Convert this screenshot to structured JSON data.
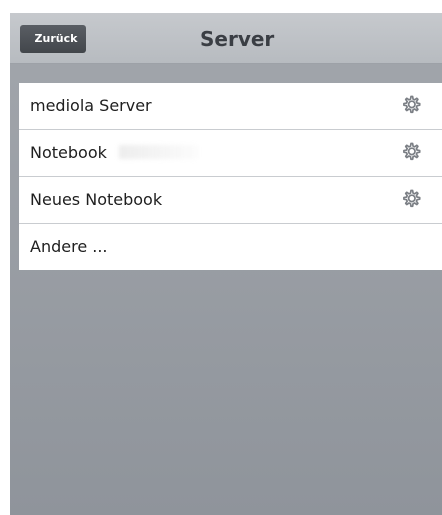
{
  "navbar": {
    "back_label": "Zurück",
    "title": "Server"
  },
  "servers": [
    {
      "label": "mediola Server",
      "has_settings": true,
      "settings_icon": "gear-icon"
    },
    {
      "label": "Notebook",
      "has_settings": true,
      "settings_icon": "gear-icon"
    },
    {
      "label": "Neues Notebook",
      "has_settings": true,
      "settings_icon": "gear-icon"
    },
    {
      "label": "Andere ...",
      "has_settings": false
    }
  ],
  "colors": {
    "navbar": "#bfc2c6",
    "back_button": "#4d5156",
    "background": "#989da3",
    "list_background": "#ffffff",
    "gear": "#7b7f85"
  }
}
